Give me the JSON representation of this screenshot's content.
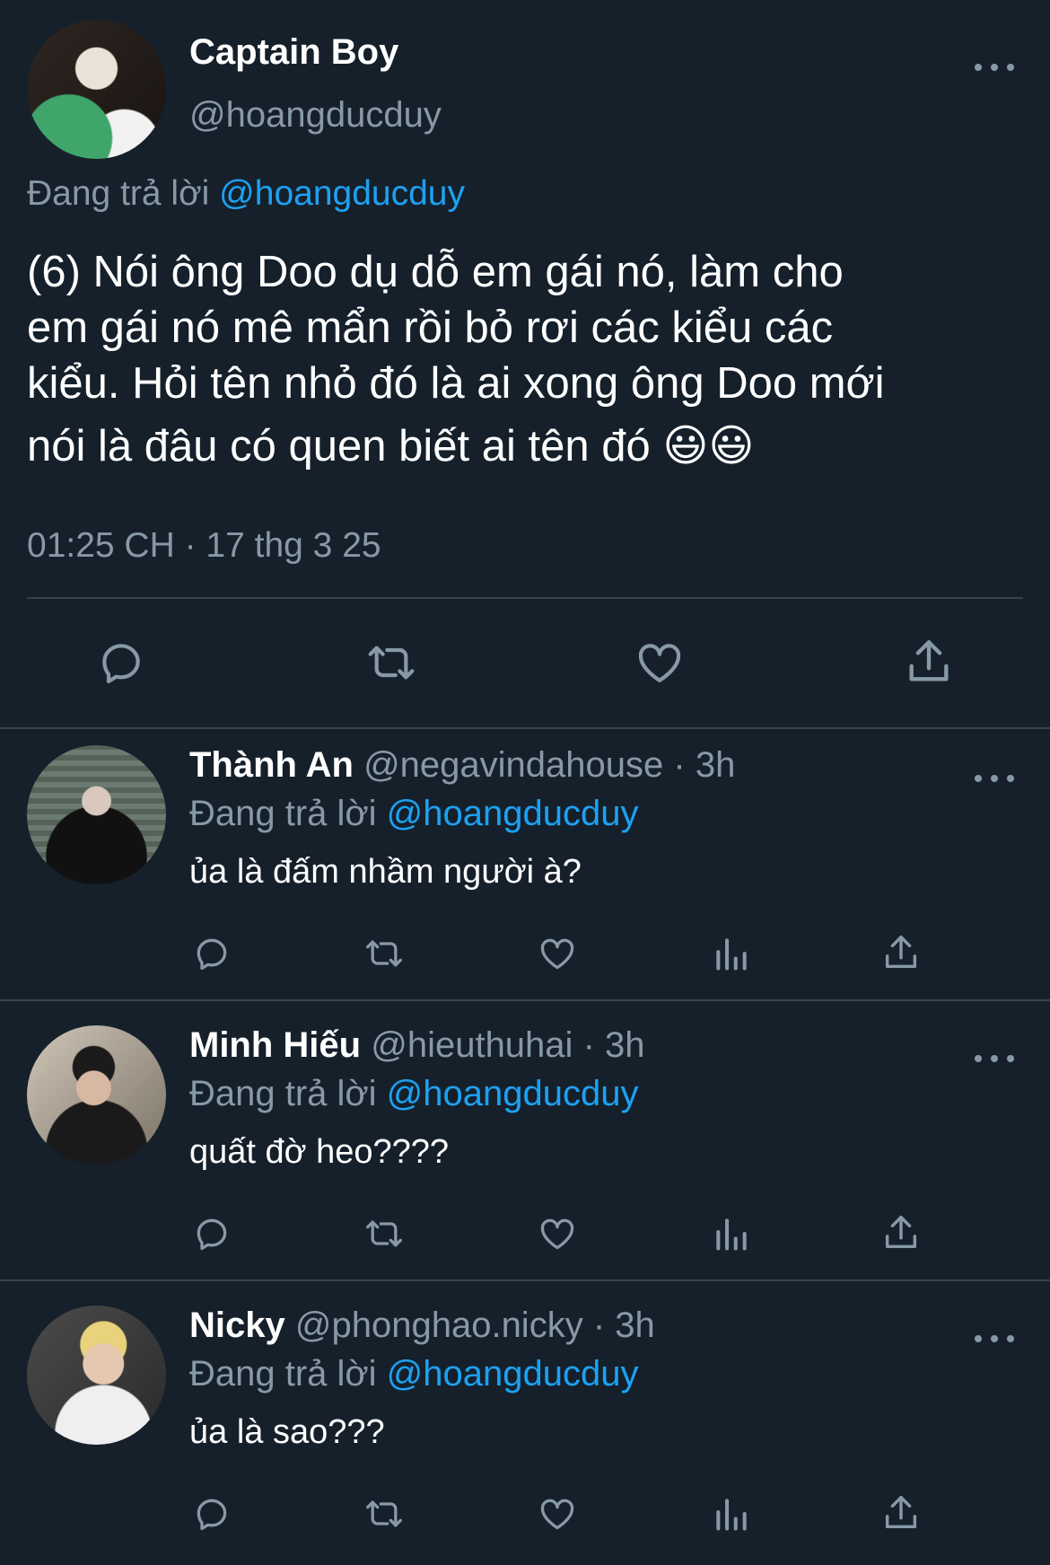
{
  "main_tweet": {
    "display_name": "Captain Boy",
    "handle": "@hoangducduy",
    "reply_prefix": "Đang trả lời",
    "reply_mention": "@hoangducduy",
    "text_lines": [
      "(6) Nói ông Doo dụ dỗ em gái nó, làm cho",
      "em gái nó mê mẩn rồi bỏ rơi các kiểu các",
      "kiểu. Hỏi tên nhỏ đó là ai xong ông Doo mới",
      "nói là đâu có quen biết ai tên đó 😃😃"
    ],
    "timestamp": "01:25 CH · 17 thg 3 25",
    "actions": [
      "reply-icon",
      "retweet-icon",
      "like-icon",
      "share-icon"
    ]
  },
  "replies": [
    {
      "display_name": "Thành An",
      "handle": "@negavindahouse",
      "time": "· 3h",
      "reply_prefix": "Đang trả lời",
      "reply_mention": "@hoangducduy",
      "text": "ủa là đấm nhầm người à?"
    },
    {
      "display_name": "Minh Hiếu",
      "handle": "@hieuthuhai",
      "time": "· 3h",
      "reply_prefix": "Đang trả lời",
      "reply_mention": "@hoangducduy",
      "text": "quất đờ heo????"
    },
    {
      "display_name": "Nicky",
      "handle": "@phonghao.nicky",
      "time": "· 3h",
      "reply_prefix": "Đang trả lời",
      "reply_mention": "@hoangducduy",
      "text": "ủa là sao???"
    }
  ],
  "reply_actions": [
    "reply-icon",
    "retweet-icon",
    "like-icon",
    "analytics-icon",
    "share-icon"
  ],
  "colors": {
    "background": "#15202b",
    "muted": "#8899a6",
    "accent": "#1da1f2",
    "divider": "#38444d"
  }
}
